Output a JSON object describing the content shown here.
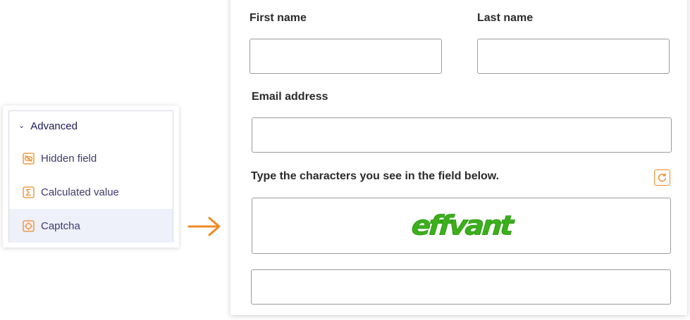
{
  "palette": {
    "group_label": "Advanced",
    "items": [
      {
        "label": "Hidden field",
        "icon": "eye-slash-icon"
      },
      {
        "label": "Calculated value",
        "icon": "sigma-icon"
      },
      {
        "label": "Captcha",
        "icon": "captcha-icon",
        "selected": true
      }
    ],
    "icon_color": "#f08a24",
    "selected_bg": "#eef0fa"
  },
  "form": {
    "first_name_label": "First name",
    "last_name_label": "Last name",
    "email_label": "Email address",
    "captcha_instruction": "Type the characters you see in the field below.",
    "captcha_text": "effvant",
    "captcha_color": "#3cb01c",
    "first_name_value": "",
    "last_name_value": "",
    "email_value": "",
    "captcha_answer_value": ""
  },
  "arrow_color": "#f08a24"
}
